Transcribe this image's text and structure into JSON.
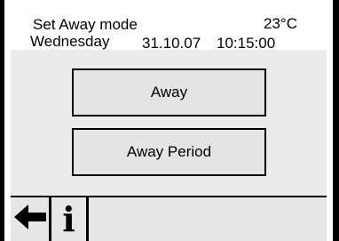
{
  "header": {
    "mode_title": "Set Away mode",
    "temperature": "23°C",
    "weekday": "Wednesday",
    "date": "31.10.07",
    "time": "10:15:00"
  },
  "menu": {
    "buttons": [
      {
        "label": "Away"
      },
      {
        "label": "Away Period"
      }
    ]
  },
  "footer": {
    "back_icon": "arrow-left-icon",
    "info_icon": "info-icon",
    "info_glyph": "i"
  }
}
